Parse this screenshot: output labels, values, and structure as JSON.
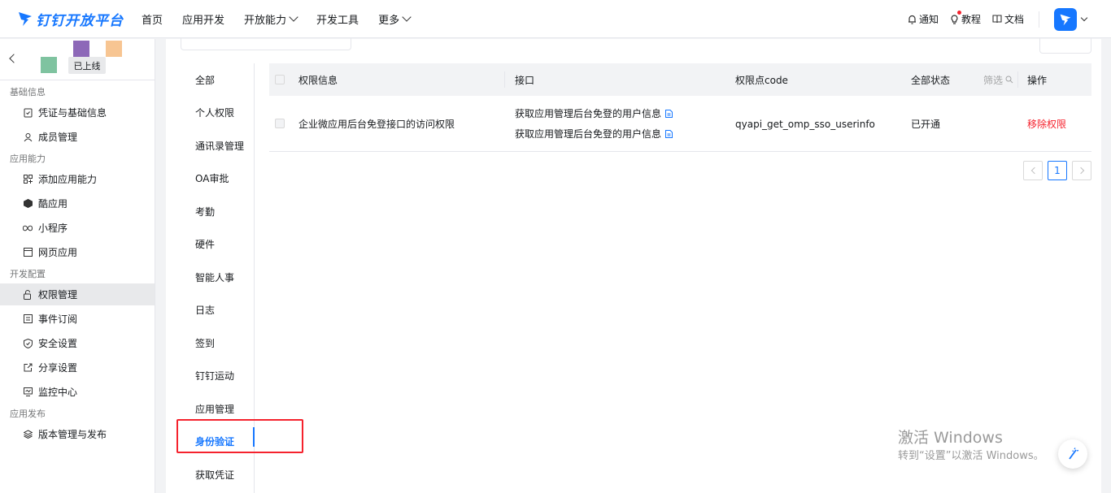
{
  "brand": {
    "name": "钉钉开放平台",
    "accent": "#1677ff"
  },
  "nav": {
    "items": [
      {
        "label": "首页",
        "has_dropdown": false
      },
      {
        "label": "应用开发",
        "has_dropdown": false
      },
      {
        "label": "开放能力",
        "has_dropdown": true
      },
      {
        "label": "开发工具",
        "has_dropdown": false
      },
      {
        "label": "更多",
        "has_dropdown": true
      }
    ],
    "right": {
      "notify": "通知",
      "tutorial": "教程",
      "docs": "文档"
    }
  },
  "sidebar": {
    "app_status": "已上线",
    "sections": [
      {
        "title": "基础信息",
        "items": [
          {
            "label": "凭证与基础信息",
            "icon": "credential-icon"
          },
          {
            "label": "成员管理",
            "icon": "user-icon"
          }
        ]
      },
      {
        "title": "应用能力",
        "items": [
          {
            "label": "添加应用能力",
            "icon": "add-capability-icon"
          },
          {
            "label": "酷应用",
            "icon": "cool-app-icon"
          },
          {
            "label": "小程序",
            "icon": "mini-program-icon"
          },
          {
            "label": "网页应用",
            "icon": "web-app-icon"
          }
        ]
      },
      {
        "title": "开发配置",
        "items": [
          {
            "label": "权限管理",
            "icon": "permission-icon",
            "active": true
          },
          {
            "label": "事件订阅",
            "icon": "event-icon"
          },
          {
            "label": "安全设置",
            "icon": "shield-icon"
          },
          {
            "label": "分享设置",
            "icon": "share-icon"
          },
          {
            "label": "监控中心",
            "icon": "monitor-icon"
          }
        ]
      },
      {
        "title": "应用发布",
        "items": [
          {
            "label": "版本管理与发布",
            "icon": "version-icon"
          }
        ]
      }
    ]
  },
  "categories": {
    "items": [
      "全部",
      "个人权限",
      "通讯录管理",
      "OA审批",
      "考勤",
      "硬件",
      "智能人事",
      "日志",
      "签到",
      "钉钉运动",
      "应用管理",
      "身份验证",
      "获取凭证"
    ],
    "active": "身份验证"
  },
  "table": {
    "headers": {
      "perm_info": "权限信息",
      "api": "接口",
      "code": "权限点code",
      "status": "全部状态",
      "filter": "筛选",
      "action": "操作"
    },
    "rows": [
      {
        "perm_info": "企业微应用后台免登接口的访问权限",
        "apis": [
          "获取应用管理后台免登的用户信息",
          "获取应用管理后台免登的用户信息"
        ],
        "code": "qyapi_get_omp_sso_userinfo",
        "status": "已开通",
        "action": "移除权限"
      }
    ]
  },
  "pagination": {
    "current": "1"
  },
  "watermark": {
    "line1": "激活 Windows",
    "line2": "转到“设置”以激活 Windows。"
  }
}
